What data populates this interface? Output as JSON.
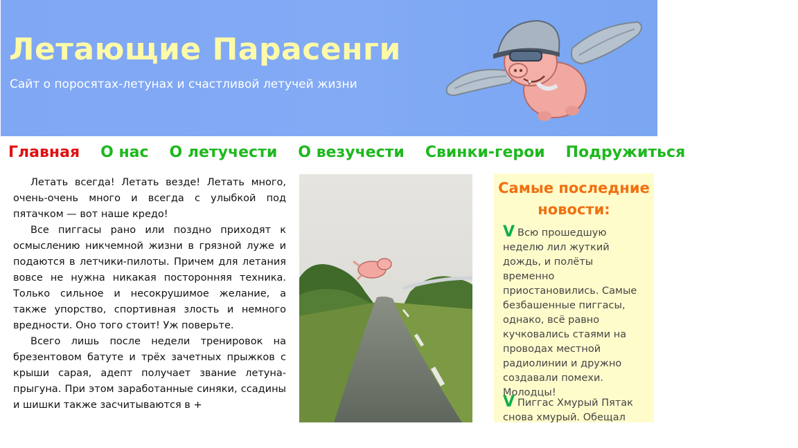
{
  "header": {
    "title": "Летающие Парасенги",
    "tagline": "Сайт о поросятах-летунах и счастливой летучей жизни",
    "logo_icon": "flying-pig-pilot-icon"
  },
  "nav": {
    "items": [
      {
        "label": "Главная",
        "active": true
      },
      {
        "label": "О нас",
        "active": false
      },
      {
        "label": "О летучести",
        "active": false
      },
      {
        "label": "О везучести",
        "active": false
      },
      {
        "label": "Свинки-герои",
        "active": false
      },
      {
        "label": "Подружиться",
        "active": false
      }
    ],
    "active_color": "#e01010",
    "color": "#1eb81e"
  },
  "article": {
    "paragraphs": [
      "Летать всегда! Летать везде! Летать много, очень-очень много и всегда с улыбкой под пятачком — вот наше кредо!",
      "Все пиггасы рано или поздно приходят к осмыслению никчемной жизни в грязной луже и подаются в летчики-пилоты. Причем для летания вовсе не нужна никакая посторонняя техника. Только сильное и несокрушимое желание, а также упорство, спортивная злость и немного вредности. Оно того стоит! Уж поверьте.",
      "Всего лишь после недели тренировок на брезентовом батуте и трёх зачетных прыжков с крыши сарая, адепт получает звание летуна-прыгуна. При этом заработанные синяки, ссадины и шишки также засчитываются в +"
    ]
  },
  "photo": {
    "icon": "pig-flying-over-road-photo"
  },
  "news": {
    "title": "Самые последние новости:",
    "check_glyph": "V",
    "items": [
      "Всю прошедшую неделю лил жуткий дождь, и полёты временно приостановились. Самые безбашенные пиггасы, однако, всё равно кучковались стаями на проводах местной радиолинии и дружно создавали помехи. Молодцы!",
      "Пиггас Хмурый Пятак снова хмурый. Обещал всех"
    ]
  }
}
